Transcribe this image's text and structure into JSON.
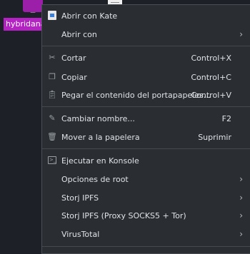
{
  "desktop": {
    "terminal_icon_glyph": "_",
    "file_label": "hybridanaly"
  },
  "menu": {
    "items": [
      {
        "label": "Abrir con Kate",
        "icon": "kate-icon"
      },
      {
        "label": "Abrir con",
        "submenu": true
      },
      {
        "label": "Cortar",
        "icon": "scissors-icon",
        "shortcut": "Control+X"
      },
      {
        "label": "Copiar",
        "icon": "copy-icon",
        "shortcut": "Control+C"
      },
      {
        "label": "Pegar el contenido del portapapeles...",
        "icon": "clipboard-icon",
        "shortcut": "Control+V"
      },
      {
        "label": "Cambiar nombre...",
        "icon": "pencil-icon",
        "shortcut": "F2"
      },
      {
        "label": "Mover a la papelera",
        "icon": "trash-icon",
        "shortcut": "Suprimir"
      },
      {
        "label": "Ejecutar en Konsole",
        "icon": "konsole-icon"
      },
      {
        "label": "Opciones de root",
        "submenu": true
      },
      {
        "label": "Storj IPFS",
        "submenu": true
      },
      {
        "label": "Storj IPFS (Proxy SOCKS5 + Tor)",
        "submenu": true
      },
      {
        "label": "VirusTotal",
        "submenu": true
      }
    ]
  },
  "colors": {
    "menu_bg": "#2a2e32",
    "accent_purple": "#b522c4",
    "desktop_bg": "#1d2026"
  }
}
